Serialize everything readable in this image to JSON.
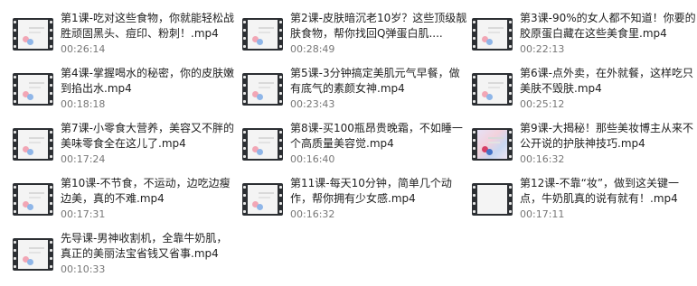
{
  "files": [
    {
      "name": "第1课-吃对这些食物，你就能轻松战胜顽固黑头、痘印、粉刺！.mp4",
      "duration": "00:26:14",
      "thumb": "pink"
    },
    {
      "name": "第2课-皮肤暗沉老10岁？这些顶级靓肤食物，帮你找回Q弹蛋白肌....",
      "duration": "00:28:49",
      "thumb": "pink"
    },
    {
      "name": "第3课-90%的女人都不知道！你要的胶原蛋白藏在这些美食里.mp4",
      "duration": "00:22:13",
      "thumb": "pink"
    },
    {
      "name": "第4课-掌握喝水的秘密，你的皮肤嫩到掐出水.mp4",
      "duration": "00:18:18",
      "thumb": "pink"
    },
    {
      "name": "第5课-3分钟搞定美肌元气早餐，做有底气的素颜女神.mp4",
      "duration": "00:23:43",
      "thumb": "pink"
    },
    {
      "name": "第6课-点外卖，在外就餐，这样吃只美肤不毁肤.mp4",
      "duration": "00:25:12",
      "thumb": "pink"
    },
    {
      "name": "第7课-小零食大营养，美容又不胖的美味零食全在这儿了.mp4",
      "duration": "00:17:24",
      "thumb": "pink"
    },
    {
      "name": "第8课-买100瓶昂贵晚霜，不如睡一个高质量美容觉.mp4",
      "duration": "00:16:40",
      "thumb": "pink"
    },
    {
      "name": "第9课-大揭秘！那些美妆博主从来不公开说的护肤神技巧.mp4",
      "duration": "00:16:32",
      "thumb": "colorful"
    },
    {
      "name": "第10课-不节食，不运动，边吃边瘦边美，真的不难.mp4",
      "duration": "00:17:31",
      "thumb": "pink"
    },
    {
      "name": "第11课-每天10分钟，简单几个动作，帮你拥有少女感.mp4",
      "duration": "00:16:32",
      "thumb": "pink"
    },
    {
      "name": "第12课-不靠“妆”，做到这关键一点，牛奶肌真的说有就有！.mp4",
      "duration": "00:17:11",
      "thumb": "blank"
    },
    {
      "name": "先导课-男神收割机，全靠牛奶肌，真正的美丽法宝省钱又省事.mp4",
      "duration": "00:10:33",
      "thumb": "pink"
    }
  ]
}
